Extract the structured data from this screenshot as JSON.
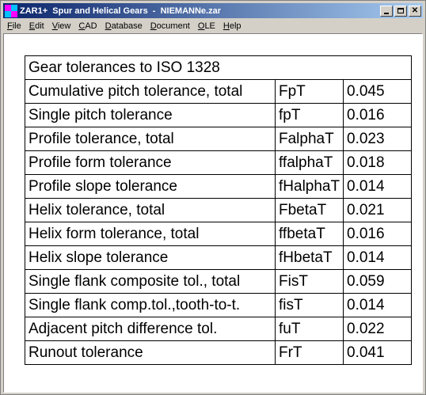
{
  "window": {
    "title": "ZAR1+  Spur and Helical Gears  -  NIEMANNe.zar",
    "buttons": [
      "minimize",
      "maximize",
      "close"
    ]
  },
  "menu": [
    {
      "label": "File",
      "underline": "F",
      "rest": "ile"
    },
    {
      "label": "Edit",
      "underline": "E",
      "rest": "dit"
    },
    {
      "label": "View",
      "underline": "V",
      "rest": "iew"
    },
    {
      "label": "CAD",
      "underline": "C",
      "rest": "AD"
    },
    {
      "label": "Database",
      "underline": "D",
      "rest": "atabase"
    },
    {
      "label": "Document",
      "underline": "D",
      "rest": "ocument"
    },
    {
      "label": "OLE",
      "underline": "O",
      "rest": "LE"
    },
    {
      "label": "Help",
      "underline": "H",
      "rest": "elp"
    }
  ],
  "table": {
    "title": "Gear tolerances to ISO 1328",
    "rows": [
      {
        "name": "Cumulative pitch tolerance, total",
        "symbol": "FpT",
        "value": "0.045"
      },
      {
        "name": "Single pitch tolerance",
        "symbol": "fpT",
        "value": "0.016"
      },
      {
        "name": "Profile tolerance, total",
        "symbol": "FalphaT",
        "value": "0.023"
      },
      {
        "name": "Profile form tolerance",
        "symbol": "ffalphaT",
        "value": "0.018"
      },
      {
        "name": "Profile slope tolerance",
        "symbol": "fHalphaT",
        "value": "0.014"
      },
      {
        "name": "Helix tolerance, total",
        "symbol": "FbetaT",
        "value": "0.021"
      },
      {
        "name": "Helix form tolerance, total",
        "symbol": "ffbetaT",
        "value": "0.016"
      },
      {
        "name": "Helix slope tolerance",
        "symbol": "fHbetaT",
        "value": "0.014"
      },
      {
        "name": "Single flank composite tol., total",
        "symbol": "FisT",
        "value": "0.059"
      },
      {
        "name": "Single flank comp.tol.,tooth-to-t.",
        "symbol": "fisT",
        "value": "0.014"
      },
      {
        "name": "Adjacent pitch difference tol.",
        "symbol": "fuT",
        "value": "0.022"
      },
      {
        "name": "Runout tolerance",
        "symbol": "FrT",
        "value": "0.041"
      }
    ]
  }
}
